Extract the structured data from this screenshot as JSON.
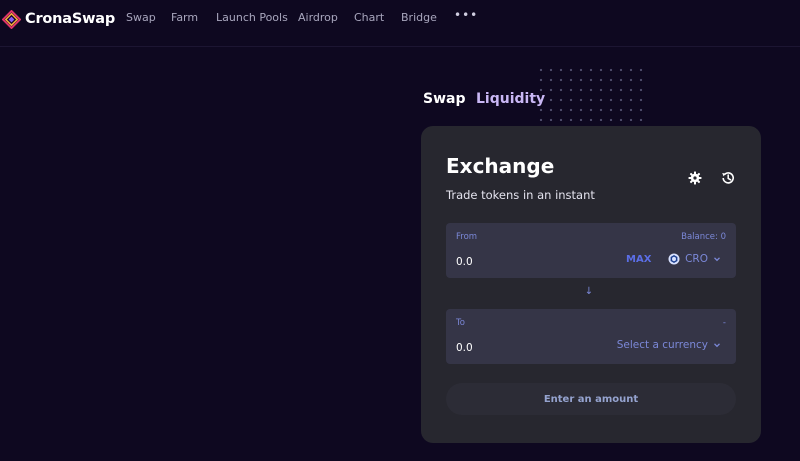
{
  "brand": {
    "name": "CronaSwap"
  },
  "nav": {
    "items": [
      {
        "label": "Swap"
      },
      {
        "label": "Farm"
      },
      {
        "label": "Launch Pools"
      },
      {
        "label": "Airdrop"
      },
      {
        "label": "Chart"
      },
      {
        "label": "Bridge"
      }
    ],
    "more": "•••"
  },
  "tabs": {
    "swap": "Swap",
    "liquidity": "Liquidity"
  },
  "exchange": {
    "title": "Exchange",
    "subtitle": "Trade tokens in an instant",
    "settings_icon": "gear-icon",
    "history_icon": "history-icon",
    "from": {
      "label": "From",
      "balance": "Balance: 0",
      "placeholder": "0.0",
      "max_label": "MAX",
      "currency": "CRO"
    },
    "to": {
      "label": "To",
      "balance": "-",
      "placeholder": "0.0",
      "currency": "Select a currency"
    },
    "switch_icon": "↓",
    "action_label": "Enter an amount"
  },
  "colors": {
    "background": "#0e0820",
    "card": "#27272f",
    "panel": "#353547",
    "accent": "#7b88d8",
    "max": "#5b6ee6",
    "liquidity_tab": "#c9b7f5"
  }
}
